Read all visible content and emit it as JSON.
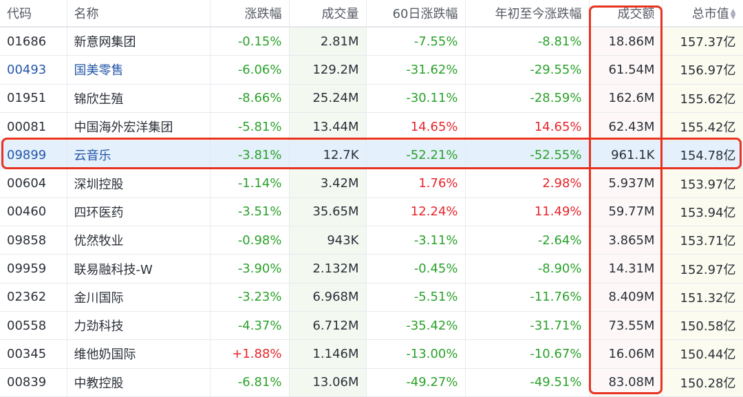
{
  "headers": [
    "代码",
    "名称",
    "涨跌幅",
    "成交量",
    "60日涨跌幅",
    "年初至今涨跌幅",
    "成交额",
    "总市值"
  ],
  "rows": [
    {
      "code": "01686",
      "name": "新意网集团",
      "chg": "-0.15%",
      "vol": "2.81M",
      "chg60": "-7.55%",
      "ytd": "-8.81%",
      "amt": "18.86M",
      "cap": "157.37亿"
    },
    {
      "code": "00493",
      "name": "国美零售",
      "chg": "-6.06%",
      "vol": "129.2M",
      "chg60": "-31.62%",
      "ytd": "-29.55%",
      "amt": "61.54M",
      "cap": "156.97亿"
    },
    {
      "code": "01951",
      "name": "锦欣生殖",
      "chg": "-8.66%",
      "vol": "25.24M",
      "chg60": "-30.11%",
      "ytd": "-28.59%",
      "amt": "162.6M",
      "cap": "155.62亿"
    },
    {
      "code": "00081",
      "name": "中国海外宏洋集团",
      "chg": "-5.81%",
      "vol": "13.44M",
      "chg60": "14.65%",
      "ytd": "14.65%",
      "amt": "62.43M",
      "cap": "155.42亿"
    },
    {
      "code": "09899",
      "name": "云音乐",
      "chg": "-3.81%",
      "vol": "12.7K",
      "chg60": "-52.21%",
      "ytd": "-52.55%",
      "amt": "961.1K",
      "cap": "154.78亿"
    },
    {
      "code": "00604",
      "name": "深圳控股",
      "chg": "-1.14%",
      "vol": "3.42M",
      "chg60": "1.76%",
      "ytd": "2.98%",
      "amt": "5.937M",
      "cap": "153.97亿"
    },
    {
      "code": "00460",
      "name": "四环医药",
      "chg": "-3.51%",
      "vol": "35.65M",
      "chg60": "12.24%",
      "ytd": "11.49%",
      "amt": "59.77M",
      "cap": "153.94亿"
    },
    {
      "code": "09858",
      "name": "优然牧业",
      "chg": "-0.98%",
      "vol": "943K",
      "chg60": "-3.11%",
      "ytd": "-2.64%",
      "amt": "3.865M",
      "cap": "153.71亿"
    },
    {
      "code": "09959",
      "name": "联易融科技-W",
      "chg": "-3.90%",
      "vol": "2.132M",
      "chg60": "-0.45%",
      "ytd": "-8.90%",
      "amt": "14.31M",
      "cap": "152.97亿"
    },
    {
      "code": "02362",
      "name": "金川国际",
      "chg": "-3.23%",
      "vol": "6.968M",
      "chg60": "-5.51%",
      "ytd": "-11.76%",
      "amt": "8.409M",
      "cap": "151.32亿"
    },
    {
      "code": "00558",
      "name": "力劲科技",
      "chg": "-4.37%",
      "vol": "6.712M",
      "chg60": "-35.42%",
      "ytd": "-31.71%",
      "amt": "73.55M",
      "cap": "150.58亿"
    },
    {
      "code": "00345",
      "name": "维他奶国际",
      "chg": "+1.88%",
      "vol": "1.146M",
      "chg60": "-13.00%",
      "ytd": "-10.67%",
      "amt": "16.06M",
      "cap": "150.44亿"
    },
    {
      "code": "00839",
      "name": "中教控股",
      "chg": "-6.81%",
      "vol": "13.06M",
      "chg60": "-49.27%",
      "ytd": "-49.51%",
      "amt": "83.08M",
      "cap": "150.28亿"
    }
  ],
  "blue_rows": [
    1,
    4
  ],
  "selected_row": 4,
  "colors": {
    "up": "#e8242a",
    "down": "#2aa12a",
    "highlight": "#e8321f"
  }
}
